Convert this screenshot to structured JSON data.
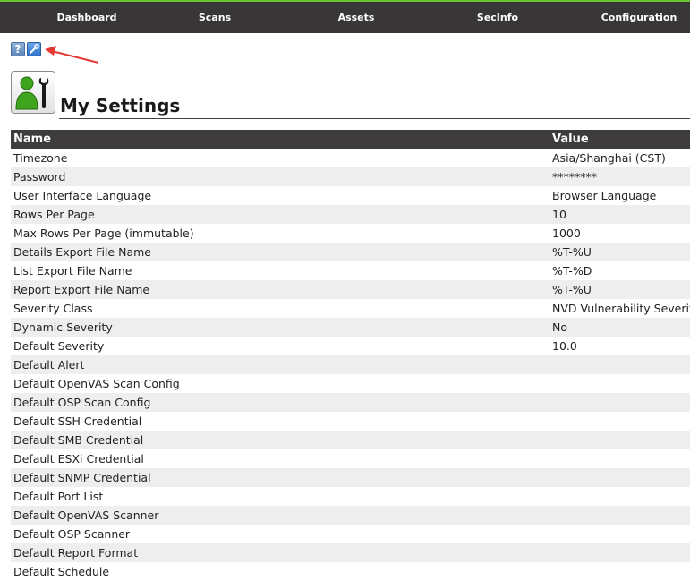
{
  "nav": {
    "items": [
      {
        "label": "Dashboard"
      },
      {
        "label": "Scans"
      },
      {
        "label": "Assets"
      },
      {
        "label": "SecInfo"
      },
      {
        "label": "Configuration"
      }
    ]
  },
  "toolbar": {
    "help_icon": "help-icon",
    "help_glyph": "?",
    "edit_icon": "edit-settings-icon",
    "annotation_color": "#e53935"
  },
  "page": {
    "title": "My Settings",
    "title_icon": "my-settings-icon"
  },
  "table": {
    "columns": {
      "name": "Name",
      "value": "Value"
    },
    "rows": [
      {
        "name": "Timezone",
        "value": "Asia/Shanghai (CST)"
      },
      {
        "name": "Password",
        "value": "********"
      },
      {
        "name": "User Interface Language",
        "value": "Browser Language"
      },
      {
        "name": "Rows Per Page",
        "value": "10"
      },
      {
        "name": "Max Rows Per Page (immutable)",
        "value": "1000"
      },
      {
        "name": "Details Export File Name",
        "value": "%T-%U"
      },
      {
        "name": "List Export File Name",
        "value": "%T-%D"
      },
      {
        "name": "Report Export File Name",
        "value": "%T-%U"
      },
      {
        "name": "Severity Class",
        "value": "NVD Vulnerability Severity"
      },
      {
        "name": "Dynamic Severity",
        "value": "No"
      },
      {
        "name": "Default Severity",
        "value": "10.0"
      },
      {
        "name": "Default Alert",
        "value": ""
      },
      {
        "name": "Default OpenVAS Scan Config",
        "value": ""
      },
      {
        "name": "Default OSP Scan Config",
        "value": ""
      },
      {
        "name": "Default SSH Credential",
        "value": ""
      },
      {
        "name": "Default SMB Credential",
        "value": ""
      },
      {
        "name": "Default ESXi Credential",
        "value": ""
      },
      {
        "name": "Default SNMP Credential",
        "value": ""
      },
      {
        "name": "Default Port List",
        "value": ""
      },
      {
        "name": "Default OpenVAS Scanner",
        "value": ""
      },
      {
        "name": "Default OSP Scanner",
        "value": ""
      },
      {
        "name": "Default Report Format",
        "value": ""
      },
      {
        "name": "Default Schedule",
        "value": ""
      }
    ]
  },
  "colors": {
    "navbar_bg": "#393637",
    "accent_green": "#66c430",
    "header_bg": "#3e3c3d",
    "row_alt_bg": "#eeeeee"
  }
}
